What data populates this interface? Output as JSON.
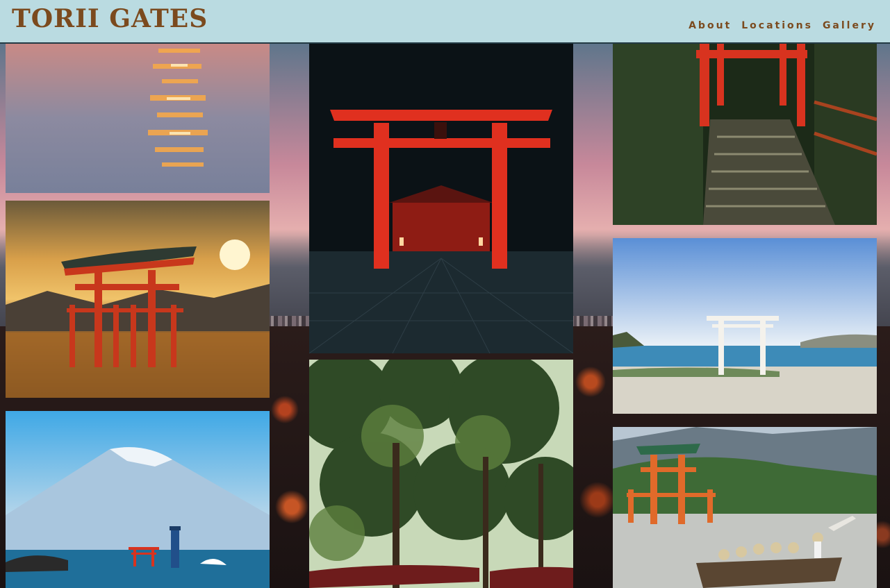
{
  "site": {
    "title": "TORII GATES"
  },
  "nav": {
    "items": [
      "About",
      "Locations",
      "Gallery"
    ]
  },
  "gallery": {
    "photos": [
      {
        "subject": "sunset reflection on water"
      },
      {
        "subject": "red torii gate at night with illuminated shrine"
      },
      {
        "subject": "path through rows of red torii gates"
      },
      {
        "subject": "floating torii gate at sunset with mountains"
      },
      {
        "subject": "white torii gate on a beach"
      },
      {
        "subject": "forest with wooden shrine roofs"
      },
      {
        "subject": "Mount Fuji with small red torii and lighthouse"
      },
      {
        "subject": "orange floating torii with boat of visitors"
      }
    ]
  },
  "colors": {
    "header_bg": "#badbe1",
    "brand": "#7b4a1e",
    "torii_red": "#d8331f"
  }
}
